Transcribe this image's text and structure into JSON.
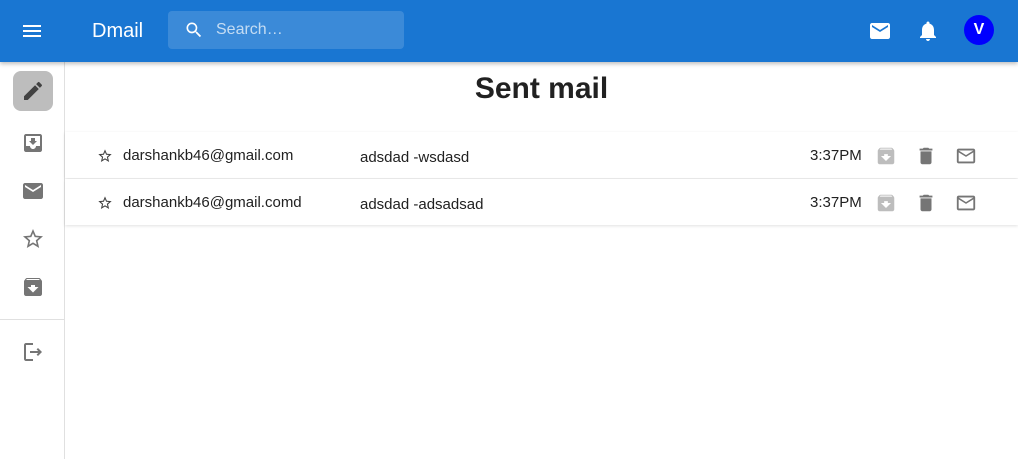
{
  "app": {
    "name": "Dmail"
  },
  "search": {
    "placeholder": "Search…"
  },
  "header": {
    "avatar_letter": "V"
  },
  "page": {
    "title": "Sent mail"
  },
  "sidebar": {
    "items": [
      {
        "icon": "pencil-icon",
        "active": true
      },
      {
        "icon": "inbox-icon"
      },
      {
        "icon": "mail-icon"
      },
      {
        "icon": "star-outline-icon"
      },
      {
        "icon": "archive-icon"
      },
      {
        "icon": "logout-icon"
      }
    ]
  },
  "mails": [
    {
      "from": "darshankb46@gmail.com",
      "subject": "adsdad -wsdasd",
      "time": "3:37PM"
    },
    {
      "from": "darshankb46@gmail.comd",
      "subject": "adsdad -adsadsad",
      "time": "3:37PM"
    }
  ],
  "colors": {
    "appbar": "#1976d2",
    "avatar": "#0000ff",
    "icon": "#757575"
  }
}
